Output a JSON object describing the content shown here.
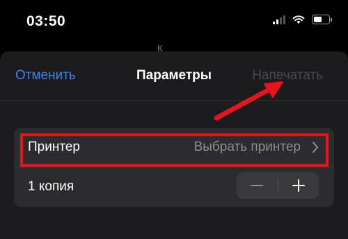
{
  "status_bar": {
    "time": "03:50",
    "icons": [
      "cellular-signal-icon",
      "wifi-icon",
      "battery-icon"
    ],
    "battery_level": 0.6
  },
  "background": {
    "partial_text": "К"
  },
  "nav": {
    "cancel_label": "Отменить",
    "title": "Параметры",
    "print_label": "Напечатать"
  },
  "options": {
    "printer_label": "Принтер",
    "printer_value": "Выбрать принтер",
    "copies_label": "1 копия",
    "stepper": {
      "minus": "−",
      "plus": "+"
    }
  },
  "annotations": {
    "highlight_color": "#e8141c",
    "arrow_color": "#e8141c"
  },
  "colors": {
    "accent": "#3a82f7",
    "disabled": "#4b4b4f",
    "sheet_bg": "#1c1c1e",
    "group_bg": "#2c2c2e"
  }
}
